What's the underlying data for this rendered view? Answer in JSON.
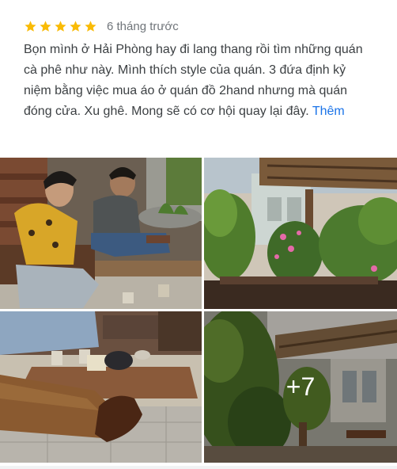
{
  "review": {
    "rating": 5,
    "max_rating": 5,
    "time_ago": "6 tháng trước",
    "text": "Bọn mình ở Hải Phòng hay đi lang thang rồi tìm những quán cà phê như này. Mình thích style của quán. 3 đứa định kỷ niệm bằng việc mua áo ở quán đồ 2hand nhưng mà quán đóng cửa. Xu ghê. Mong sẽ có cơ hội quay lại đây.",
    "more_label": "Thêm"
  },
  "photos": {
    "items": [
      {
        "name": "photo-friends-sitting"
      },
      {
        "name": "photo-garden-terrace"
      },
      {
        "name": "photo-table-legs"
      },
      {
        "name": "photo-cafe-plants"
      }
    ],
    "more_count": "+7"
  },
  "colors": {
    "star": "#f9bb06",
    "link": "#1a73e8",
    "time": "#70757a"
  }
}
